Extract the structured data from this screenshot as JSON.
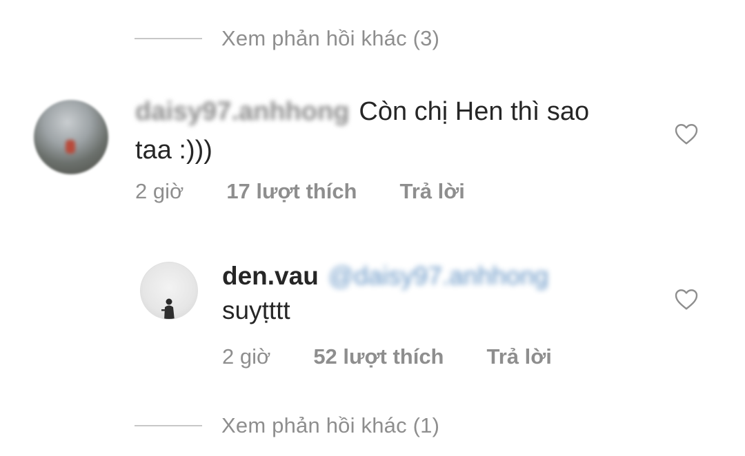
{
  "thread": {
    "view_more_top": "Xem phản hồi khác (3)",
    "view_more_bottom": "Xem phản hồi khác (1)"
  },
  "comment1": {
    "username": "daisy97.anhhong",
    "text": "Còn chị Hen thì sao taa :)))",
    "time": "2 giờ",
    "likes": "17 lượt thích",
    "reply": "Trả lời"
  },
  "comment2": {
    "username": "den.vau",
    "mention": "@daisy97.anhhong",
    "text": "suyṭttt",
    "time": "2 giờ",
    "likes": "52 lượt thích",
    "reply": "Trả lời"
  },
  "icons": {
    "like": "heart-outline-icon"
  },
  "colors": {
    "secondary_text": "#8e8e8e",
    "primary_text": "#262626",
    "mention": "#2f6fb0"
  }
}
